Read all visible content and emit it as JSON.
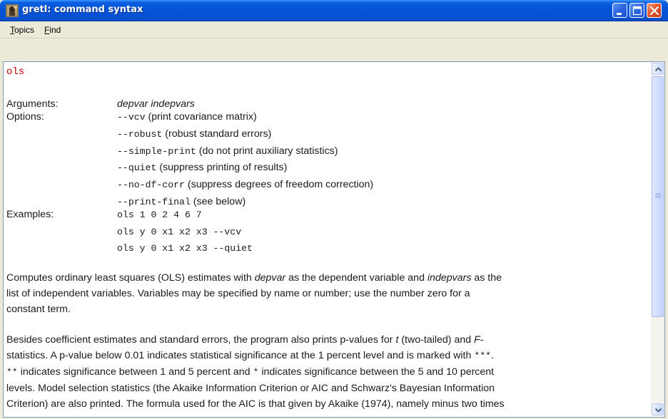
{
  "window": {
    "title": "gretl: command syntax",
    "app_icon": "gretl-icon",
    "controls": [
      "minimize-icon",
      "maximize-icon",
      "close-icon"
    ]
  },
  "menubar": {
    "items": [
      {
        "label": "Topics",
        "mnemonic": "T",
        "rest": "opics"
      },
      {
        "label": "Find",
        "mnemonic": "F",
        "rest": "ind"
      }
    ]
  },
  "help": {
    "command": "ols",
    "arguments_label": "Arguments:",
    "arguments_value": "depvar indepvars",
    "options_label": "Options:",
    "options": [
      {
        "flag": "--vcv",
        "desc": " (print covariance matrix)"
      },
      {
        "flag": "--robust",
        "desc": " (robust standard errors)"
      },
      {
        "flag": "--simple-print",
        "desc": " (do not print auxiliary statistics)"
      },
      {
        "flag": "--quiet",
        "desc": " (suppress printing of results)"
      },
      {
        "flag": "--no-df-corr",
        "desc": " (suppress degrees of freedom correction)"
      },
      {
        "flag": "--print-final",
        "desc": " (see below)"
      }
    ],
    "examples_label": "Examples:",
    "examples": [
      "ols 1 0 2 4 6 7",
      "ols y 0 x1 x2 x3 --vcv",
      "ols y 0 x1 x2 x3 --quiet"
    ],
    "para1": {
      "l1a": "Computes ordinary least squares (OLS) estimates with ",
      "l1b": "depvar",
      "l1c": " as the dependent variable and ",
      "l1d": "indepvars",
      "l1e": " as the",
      "l2": "list of independent variables. Variables may be specified by name or number; use the number zero for a",
      "l3": "constant term."
    },
    "para2": {
      "l1a": "Besides coefficient estimates and standard errors, the program also prints p-values for ",
      "l1b": "t",
      "l1c": " (two-tailed) and ",
      "l1d": "F",
      "l1e": "-",
      "l2a": "statistics. A p-value below 0.01 indicates statistical significance at the 1 percent level and is marked with ",
      "l2b": "***",
      "l2c": ".",
      "l3a": "**",
      "l3b": " indicates significance between 1 and 5 percent and ",
      "l3c": "*",
      "l3d": " indicates significance between the 5 and 10 percent",
      "l4": "levels. Model selection statistics (the Akaike Information Criterion or AIC and Schwarz's Bayesian Information",
      "l5": "Criterion) are also printed. The formula used for the AIC is that given by Akaike (1974), namely minus two times"
    }
  },
  "scrollbar": {
    "up_icon": "scroll-up-arrow-icon",
    "down_icon": "scroll-down-arrow-icon"
  }
}
